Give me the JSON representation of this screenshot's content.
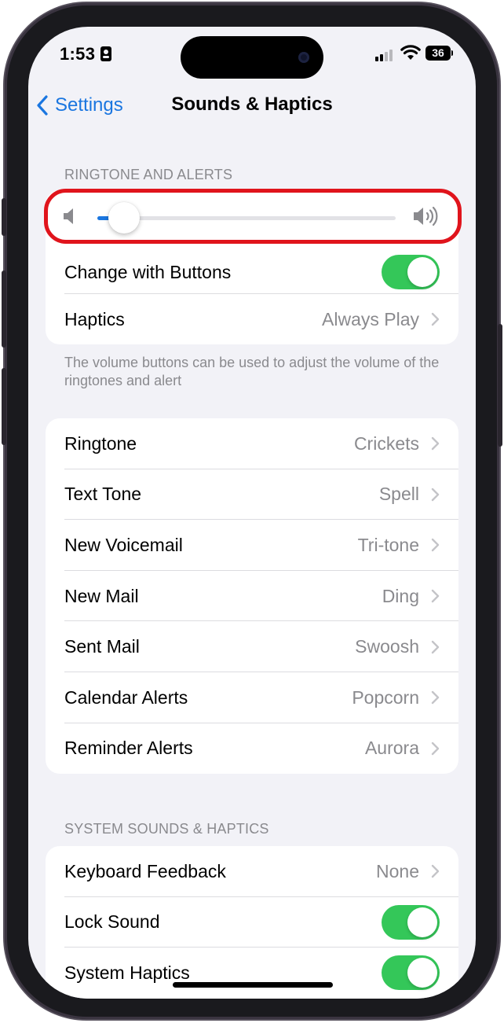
{
  "status_bar": {
    "time": "1:53",
    "battery": "36"
  },
  "nav": {
    "back_label": "Settings",
    "title": "Sounds & Haptics"
  },
  "ringtone_section": {
    "header": "RINGTONE AND ALERTS",
    "volume_level": 0.09,
    "change_with_buttons_label": "Change with Buttons",
    "change_with_buttons_on": true,
    "haptics_label": "Haptics",
    "haptics_value": "Always Play",
    "footnote": "The volume buttons can be used to adjust the volume of the ringtones and alert"
  },
  "sounds": [
    {
      "label": "Ringtone",
      "value": "Crickets"
    },
    {
      "label": "Text Tone",
      "value": "Spell"
    },
    {
      "label": "New Voicemail",
      "value": "Tri-tone"
    },
    {
      "label": "New Mail",
      "value": "Ding"
    },
    {
      "label": "Sent Mail",
      "value": "Swoosh"
    },
    {
      "label": "Calendar Alerts",
      "value": "Popcorn"
    },
    {
      "label": "Reminder Alerts",
      "value": "Aurora"
    }
  ],
  "system_section": {
    "header": "SYSTEM SOUNDS & HAPTICS",
    "keyboard_feedback_label": "Keyboard Feedback",
    "keyboard_feedback_value": "None",
    "lock_sound_label": "Lock Sound",
    "lock_sound_on": true,
    "system_haptics_label": "System Haptics",
    "system_haptics_on": true
  },
  "colors": {
    "accent": "#1a76e0",
    "toggle_on": "#34c759",
    "highlight": "#e0141c",
    "background": "#f2f2f7"
  }
}
